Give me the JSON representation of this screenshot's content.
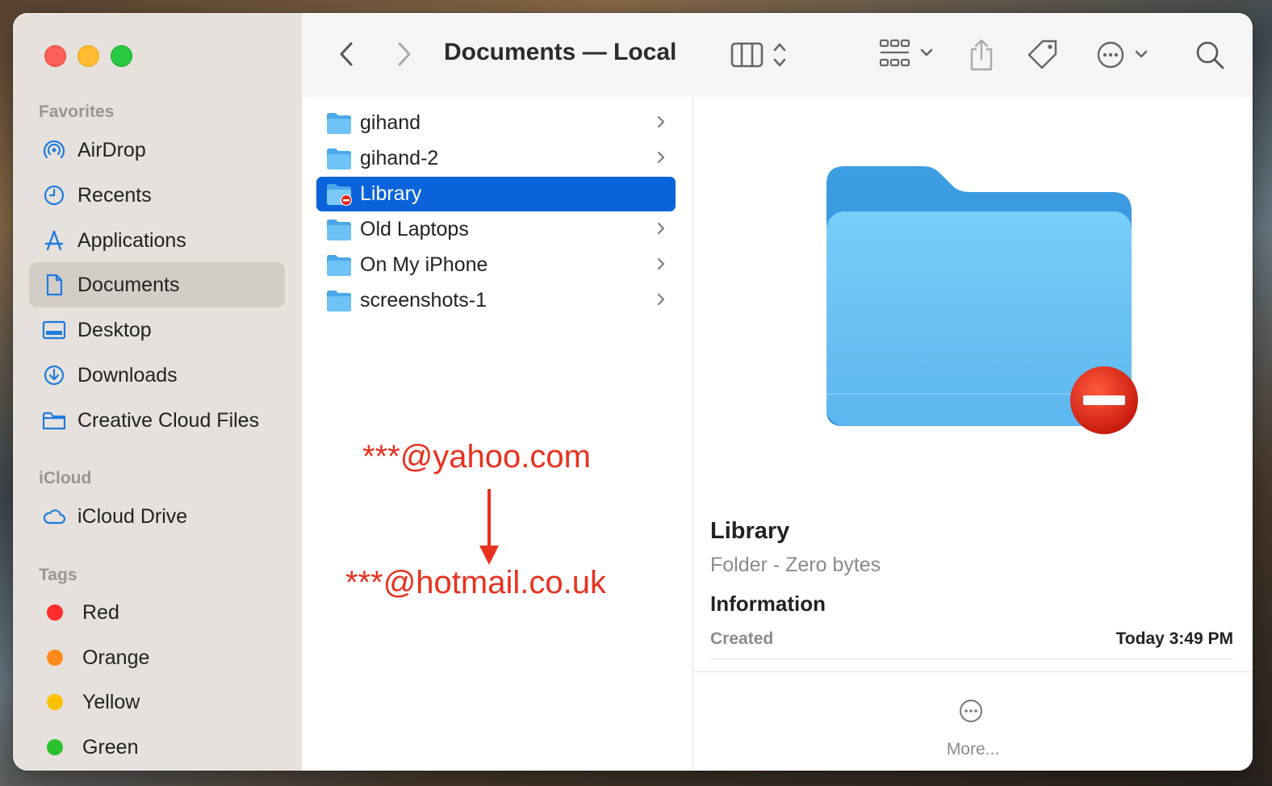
{
  "window": {
    "title": "Documents — Local"
  },
  "sidebar": {
    "favorites_label": "Favorites",
    "favorites": [
      {
        "label": "AirDrop",
        "icon": "airdrop-icon"
      },
      {
        "label": "Recents",
        "icon": "clock-icon"
      },
      {
        "label": "Applications",
        "icon": "applications-icon"
      },
      {
        "label": "Documents",
        "icon": "document-icon",
        "selected": true
      },
      {
        "label": "Desktop",
        "icon": "desktop-icon"
      },
      {
        "label": "Downloads",
        "icon": "download-icon"
      },
      {
        "label": "Creative Cloud Files",
        "icon": "folder-icon"
      }
    ],
    "icloud_label": "iCloud",
    "icloud": [
      {
        "label": "iCloud Drive",
        "icon": "cloud-icon"
      }
    ],
    "tags_label": "Tags",
    "tags": [
      {
        "label": "Red",
        "color": "#fe2d2d"
      },
      {
        "label": "Orange",
        "color": "#ff8a1c"
      },
      {
        "label": "Yellow",
        "color": "#fdc000"
      },
      {
        "label": "Green",
        "color": "#2bc230"
      }
    ]
  },
  "files": [
    {
      "name": "gihand",
      "has_children": true
    },
    {
      "name": "gihand-2",
      "has_children": true
    },
    {
      "name": "Library",
      "has_children": false,
      "selected": true,
      "restricted": true
    },
    {
      "name": "Old Laptops",
      "has_children": true
    },
    {
      "name": "On My iPhone",
      "has_children": true
    },
    {
      "name": "screenshots-1",
      "has_children": true
    }
  ],
  "annotation": {
    "from": "***@yahoo.com",
    "to": "***@hotmail.co.uk",
    "color": "#e8311f"
  },
  "preview": {
    "name": "Library",
    "subtitle": "Folder - Zero bytes",
    "info_heading": "Information",
    "created_label": "Created",
    "created_value": "Today 3:49 PM",
    "more_label": "More..."
  },
  "colors": {
    "accent": "#0a63d9",
    "folder": "#5ab8f0",
    "sidebar_bg": "#e6e1dc"
  }
}
